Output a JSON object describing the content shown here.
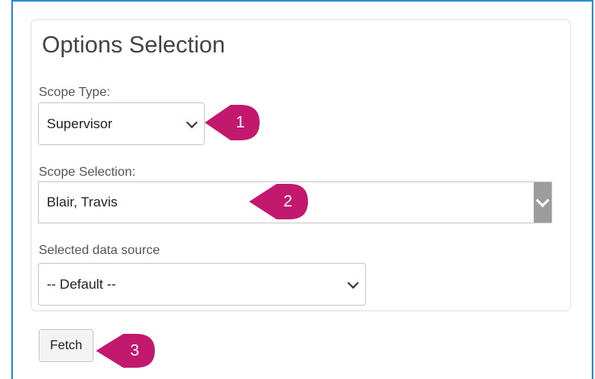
{
  "panel": {
    "title": "Options Selection"
  },
  "scope_type": {
    "label": "Scope Type:",
    "value": "Supervisor"
  },
  "scope_selection": {
    "label": "Scope Selection:",
    "value": "Blair, Travis"
  },
  "data_source": {
    "label": "Selected data source",
    "value": "-- Default --"
  },
  "fetch_button": {
    "label": "Fetch"
  },
  "callouts": [
    {
      "number": "1"
    },
    {
      "number": "2"
    },
    {
      "number": "3"
    }
  ],
  "colors": {
    "callout": "#c2186e",
    "frame": "#2a8fd0"
  }
}
